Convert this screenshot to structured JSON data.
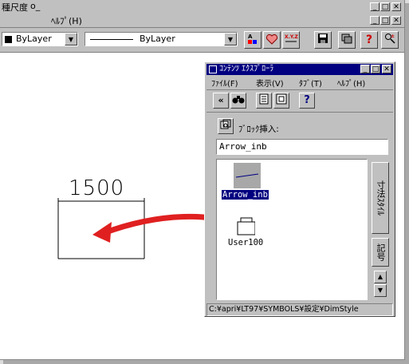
{
  "app": {
    "menu": [
      "種尺度",
      "o_",
      "ﾍﾙﾌﾟ(H)"
    ],
    "window_controls": [
      "_",
      "□",
      "✕"
    ]
  },
  "toolbar": {
    "layer_value": "ByLayer",
    "linetype_value": "ByLayer",
    "icons": [
      "layer-color-icon",
      "heart-icon",
      "xyz-icon",
      "save-icon",
      "copy-window-icon",
      "help-icon",
      "zoom-icon"
    ]
  },
  "drawing": {
    "dimension_text": "1500"
  },
  "content_explorer": {
    "title": "ｺﾝﾃﾝﾂ ｴｸｽﾌﾟﾛｰﾗ",
    "menu": [
      "ﾌｧｲﾙ(F)",
      "表示(V)",
      "ﾀﾌﾞ(T)",
      "ﾍﾙﾌﾟ(H)"
    ],
    "toolbar": [
      "«",
      "binoculars-icon",
      "list-icon",
      "window-icon",
      "?"
    ],
    "block_insert_label": "ﾌﾞﾛｯｸ挿入:",
    "block_name": "Arrow_inb",
    "items": [
      {
        "label": "Arrow_inb",
        "selected": true
      },
      {
        "label": "User100",
        "selected": false
      }
    ],
    "side_tabs": [
      "寸法ｽﾀｲﾙ",
      "記号"
    ],
    "status_path": "C:¥apri¥LT97¥SYMBOLS¥設定¥DimStyle"
  }
}
